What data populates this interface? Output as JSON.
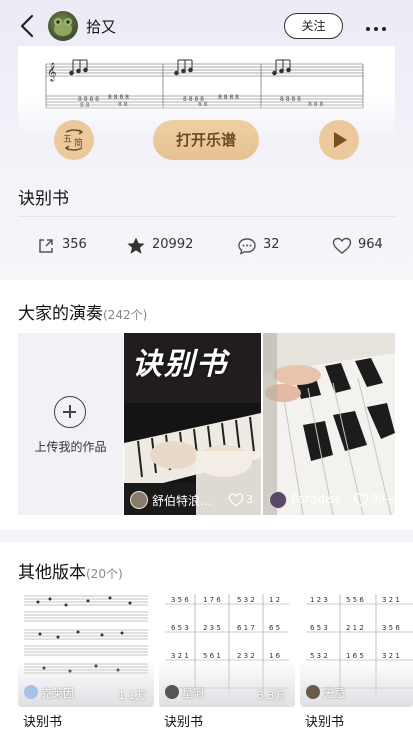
{
  "header": {
    "username": "拾又",
    "follow_label": "关注"
  },
  "sheet": {
    "notation_toggle_label": "五\n简",
    "open_label": "打开乐谱"
  },
  "song": {
    "title": "诀别书"
  },
  "stats": {
    "shares": "356",
    "favorites": "20992",
    "comments": "32",
    "likes": "964"
  },
  "performances": {
    "title": "大家的演奏",
    "count": "(242个)",
    "upload_label": "上传我的作品",
    "items": [
      {
        "overlay_title": "诀别书",
        "author": "舒伯特浪…",
        "likes": "3"
      },
      {
        "overlay_title": "",
        "author": "Paradise",
        "likes": "99+"
      }
    ]
  },
  "versions": {
    "title": "其他版本",
    "count": "(20个)",
    "items": [
      {
        "name": "诀别书",
        "uploader": "克莱因",
        "views": "1.1万"
      },
      {
        "name": "诀别书",
        "uploader": "星河",
        "views": "3.3万"
      },
      {
        "name": "诀别书",
        "uploader": "无忌",
        "views": ""
      }
    ]
  },
  "colors": {
    "accent": "#ecc99c",
    "accent_text": "#6d4a22"
  }
}
